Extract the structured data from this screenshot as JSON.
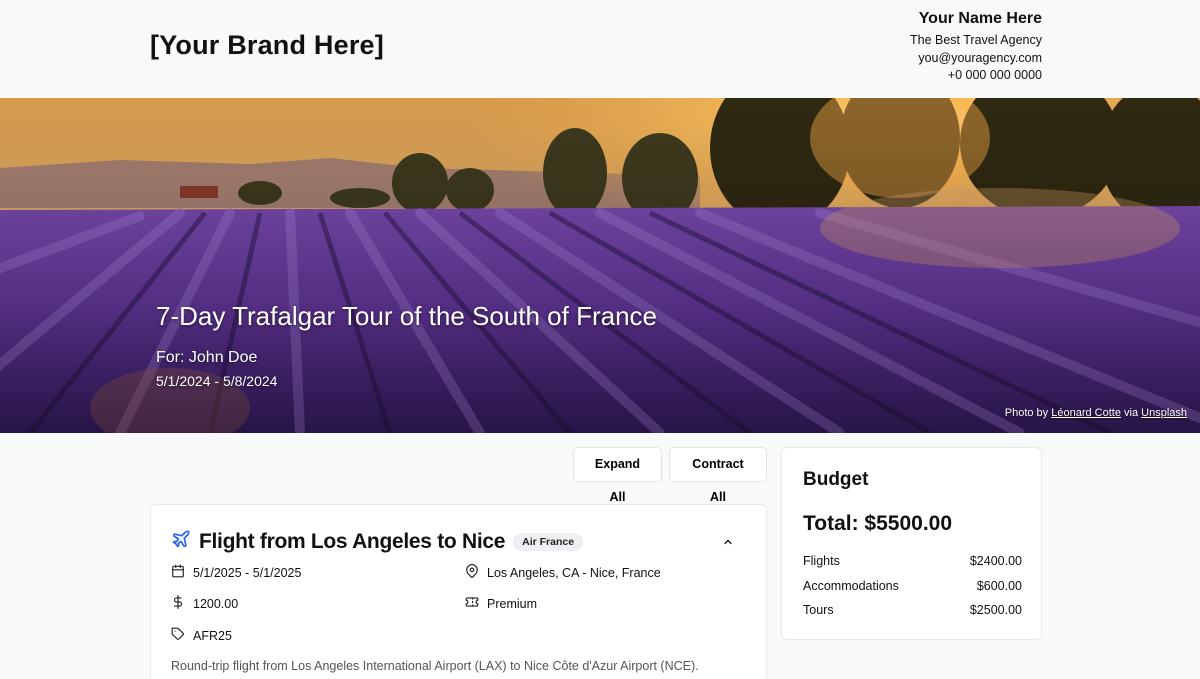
{
  "header": {
    "brand": "[Your Brand Here]",
    "agent_name": "Your Name Here",
    "agency": "The Best Travel Agency",
    "email": "you@youragency.com",
    "phone": "+0 000 000 0000"
  },
  "hero": {
    "title": "7-Day Trafalgar Tour of the South of France",
    "for_label": "For: John Doe",
    "dates": "5/1/2024 - 5/8/2024",
    "credit_prefix": "Photo by ",
    "credit_author": "Léonard Cotte",
    "credit_via": " via ",
    "credit_site": "Unsplash"
  },
  "controls": {
    "expand_all": "Expand All",
    "contract_all": "Contract All"
  },
  "flight_card": {
    "title": "Flight from Los Angeles to Nice",
    "badge": "Air France",
    "dates": "5/1/2025 - 5/1/2025",
    "location": "Los Angeles, CA - Nice, France",
    "price": "1200.00",
    "class": "Premium",
    "code": "AFR25",
    "description": "Round-trip flight from Los Angeles International Airport (LAX) to Nice Côte d'Azur Airport (NCE)."
  },
  "budget": {
    "title": "Budget",
    "total": "Total: $5500.00",
    "items": [
      {
        "label": "Flights",
        "amount": "$2400.00"
      },
      {
        "label": "Accommodations",
        "amount": "$600.00"
      },
      {
        "label": "Tours",
        "amount": "$2500.00"
      }
    ]
  },
  "colors": {
    "accent": "#2563eb",
    "background": "#f8f9fb"
  }
}
